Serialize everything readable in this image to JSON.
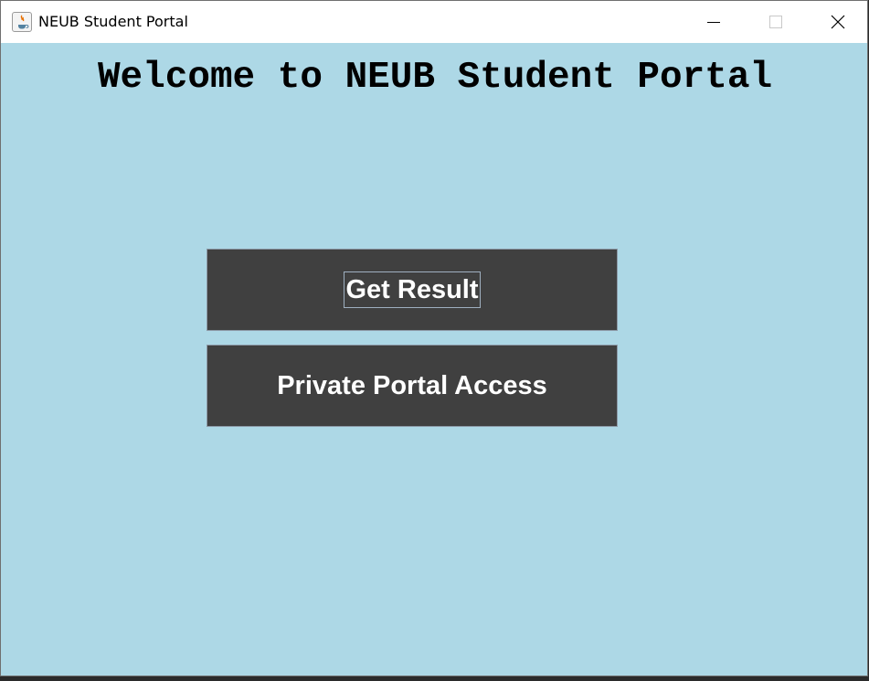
{
  "window": {
    "title": "NEUB Student Portal",
    "icon": "java-app-icon",
    "controls": {
      "minimize": "minimize-icon",
      "maximize": "maximize-icon",
      "close": "close-icon"
    }
  },
  "main": {
    "heading": "Welcome to NEUB Student Portal",
    "buttons": {
      "get_result": "Get Result",
      "private_portal": "Private Portal Access"
    }
  },
  "colors": {
    "background": "#add8e6",
    "button": "#404040",
    "button_text": "#ffffff",
    "heading_text": "#000000"
  }
}
